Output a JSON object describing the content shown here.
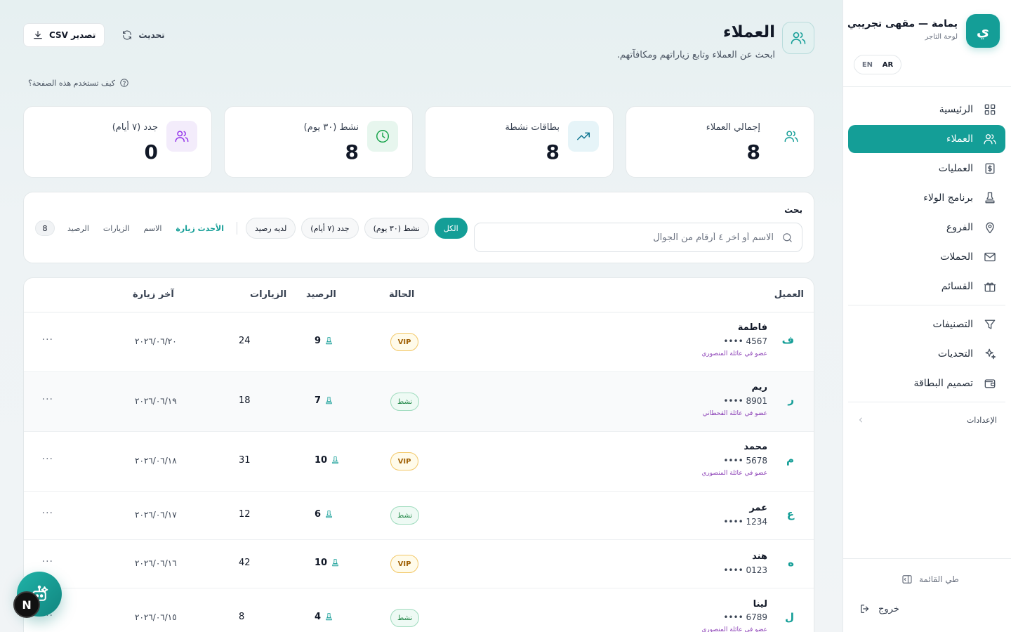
{
  "brand": {
    "logo_letter": "ي",
    "name": "يمامة — مقهى تجريبي",
    "subtitle": "لوحة التاجر"
  },
  "language": {
    "ar": "AR",
    "en": "EN",
    "selected": "AR"
  },
  "nav": {
    "items": [
      {
        "label": "الرئيسية",
        "icon": "grid-icon",
        "active": false
      },
      {
        "label": "العملاء",
        "icon": "users-icon",
        "active": true
      },
      {
        "label": "العمليات",
        "icon": "receipt-icon",
        "active": false
      },
      {
        "label": "برنامج الولاء",
        "icon": "stamp-icon",
        "active": false
      },
      {
        "label": "الفروع",
        "icon": "map-pin-icon",
        "active": false
      },
      {
        "label": "الحملات",
        "icon": "mail-icon",
        "active": false
      },
      {
        "label": "القسائم",
        "icon": "gift-icon",
        "active": false
      }
    ],
    "secondary": [
      {
        "label": "التصنيفات",
        "icon": "filter-icon"
      },
      {
        "label": "التحديات",
        "icon": "sparkles-icon"
      },
      {
        "label": "تصميم البطاقة",
        "icon": "wallet-icon"
      }
    ],
    "settings_label": "الإعدادات",
    "collapse_label": "طي القائمة",
    "logout_label": "خروج"
  },
  "header": {
    "title": "العملاء",
    "subtitle": "ابحث عن العملاء وتابع زياراتهم ومكافآتهم.",
    "export_label": "تصدير CSV",
    "refresh_label": "تحديث",
    "help_label": "كيف تستخدم هذه الصفحة؟"
  },
  "stats": [
    {
      "label": "إجمالي العملاء",
      "value": "8",
      "icon": "users-icon",
      "color": "#149e97"
    },
    {
      "label": "بطاقات نشطة",
      "value": "8",
      "icon": "trending-up-icon",
      "color": "#0e7490"
    },
    {
      "label": "نشط (٣٠ يوم)",
      "value": "8",
      "icon": "clock-icon",
      "color": "#16a34a"
    },
    {
      "label": "جدد (٧ أيام)",
      "value": "0",
      "icon": "users-icon",
      "color": "#9333ea"
    }
  ],
  "filters": {
    "search_label": "بحث",
    "search_placeholder": "الاسم أو آخر ٤ أرقام من الجوال",
    "search_value": "",
    "chips": [
      {
        "label": "الكل",
        "active": true
      },
      {
        "label": "نشط (٣٠ يوم)",
        "active": false
      },
      {
        "label": "جدد (٧ أيام)",
        "active": false
      },
      {
        "label": "لديه رصيد",
        "active": false
      }
    ],
    "sort": [
      {
        "label": "الأحدث زيارة",
        "active": true
      },
      {
        "label": "الاسم",
        "active": false
      },
      {
        "label": "الزيارات",
        "active": false
      },
      {
        "label": "الرصيد",
        "active": false
      }
    ],
    "count": "8"
  },
  "table": {
    "columns": {
      "customer": "العميل",
      "status": "الحالة",
      "balance": "الرصيد",
      "visits": "الزيارات",
      "last_visit": "آخر زيارة"
    },
    "rows": [
      {
        "letter": "ف",
        "name": "فاطمة",
        "phone": "•••• 4567",
        "family": "عضو في عائلة المنصوري",
        "status": "VIP",
        "status_type": "vip",
        "balance": "9",
        "visits": "24",
        "last_visit": "٢٠٢٦/٠٦/٢٠"
      },
      {
        "letter": "ر",
        "name": "ريم",
        "phone": "•••• 8901",
        "family": "عضو في عائلة القحطاني",
        "status": "نشط",
        "status_type": "active",
        "balance": "7",
        "visits": "18",
        "last_visit": "٢٠٢٦/٠٦/١٩"
      },
      {
        "letter": "م",
        "name": "محمد",
        "phone": "•••• 5678",
        "family": "عضو في عائلة المنصوري",
        "status": "VIP",
        "status_type": "vip",
        "balance": "10",
        "visits": "31",
        "last_visit": "٢٠٢٦/٠٦/١٨"
      },
      {
        "letter": "ع",
        "name": "عمر",
        "phone": "•••• 1234",
        "family": "",
        "status": "نشط",
        "status_type": "active",
        "balance": "6",
        "visits": "12",
        "last_visit": "٢٠٢٦/٠٦/١٧"
      },
      {
        "letter": "ه",
        "name": "هند",
        "phone": "•••• 0123",
        "family": "",
        "status": "VIP",
        "status_type": "vip",
        "balance": "10",
        "visits": "42",
        "last_visit": "٢٠٢٦/٠٦/١٦"
      },
      {
        "letter": "ل",
        "name": "لينا",
        "phone": "•••• 6789",
        "family": "عضو في عائلة المنصوري",
        "status": "نشط",
        "status_type": "active",
        "balance": "4",
        "visits": "8",
        "last_visit": "٢٠٢٦/٠٦/١٥"
      }
    ],
    "row_menu": "···"
  },
  "assistant": {
    "badge_letter": "N"
  },
  "colors": {
    "accent": "#149e97",
    "vip": "#a16207",
    "active": "#15803d",
    "family": "#8b3fb6"
  }
}
